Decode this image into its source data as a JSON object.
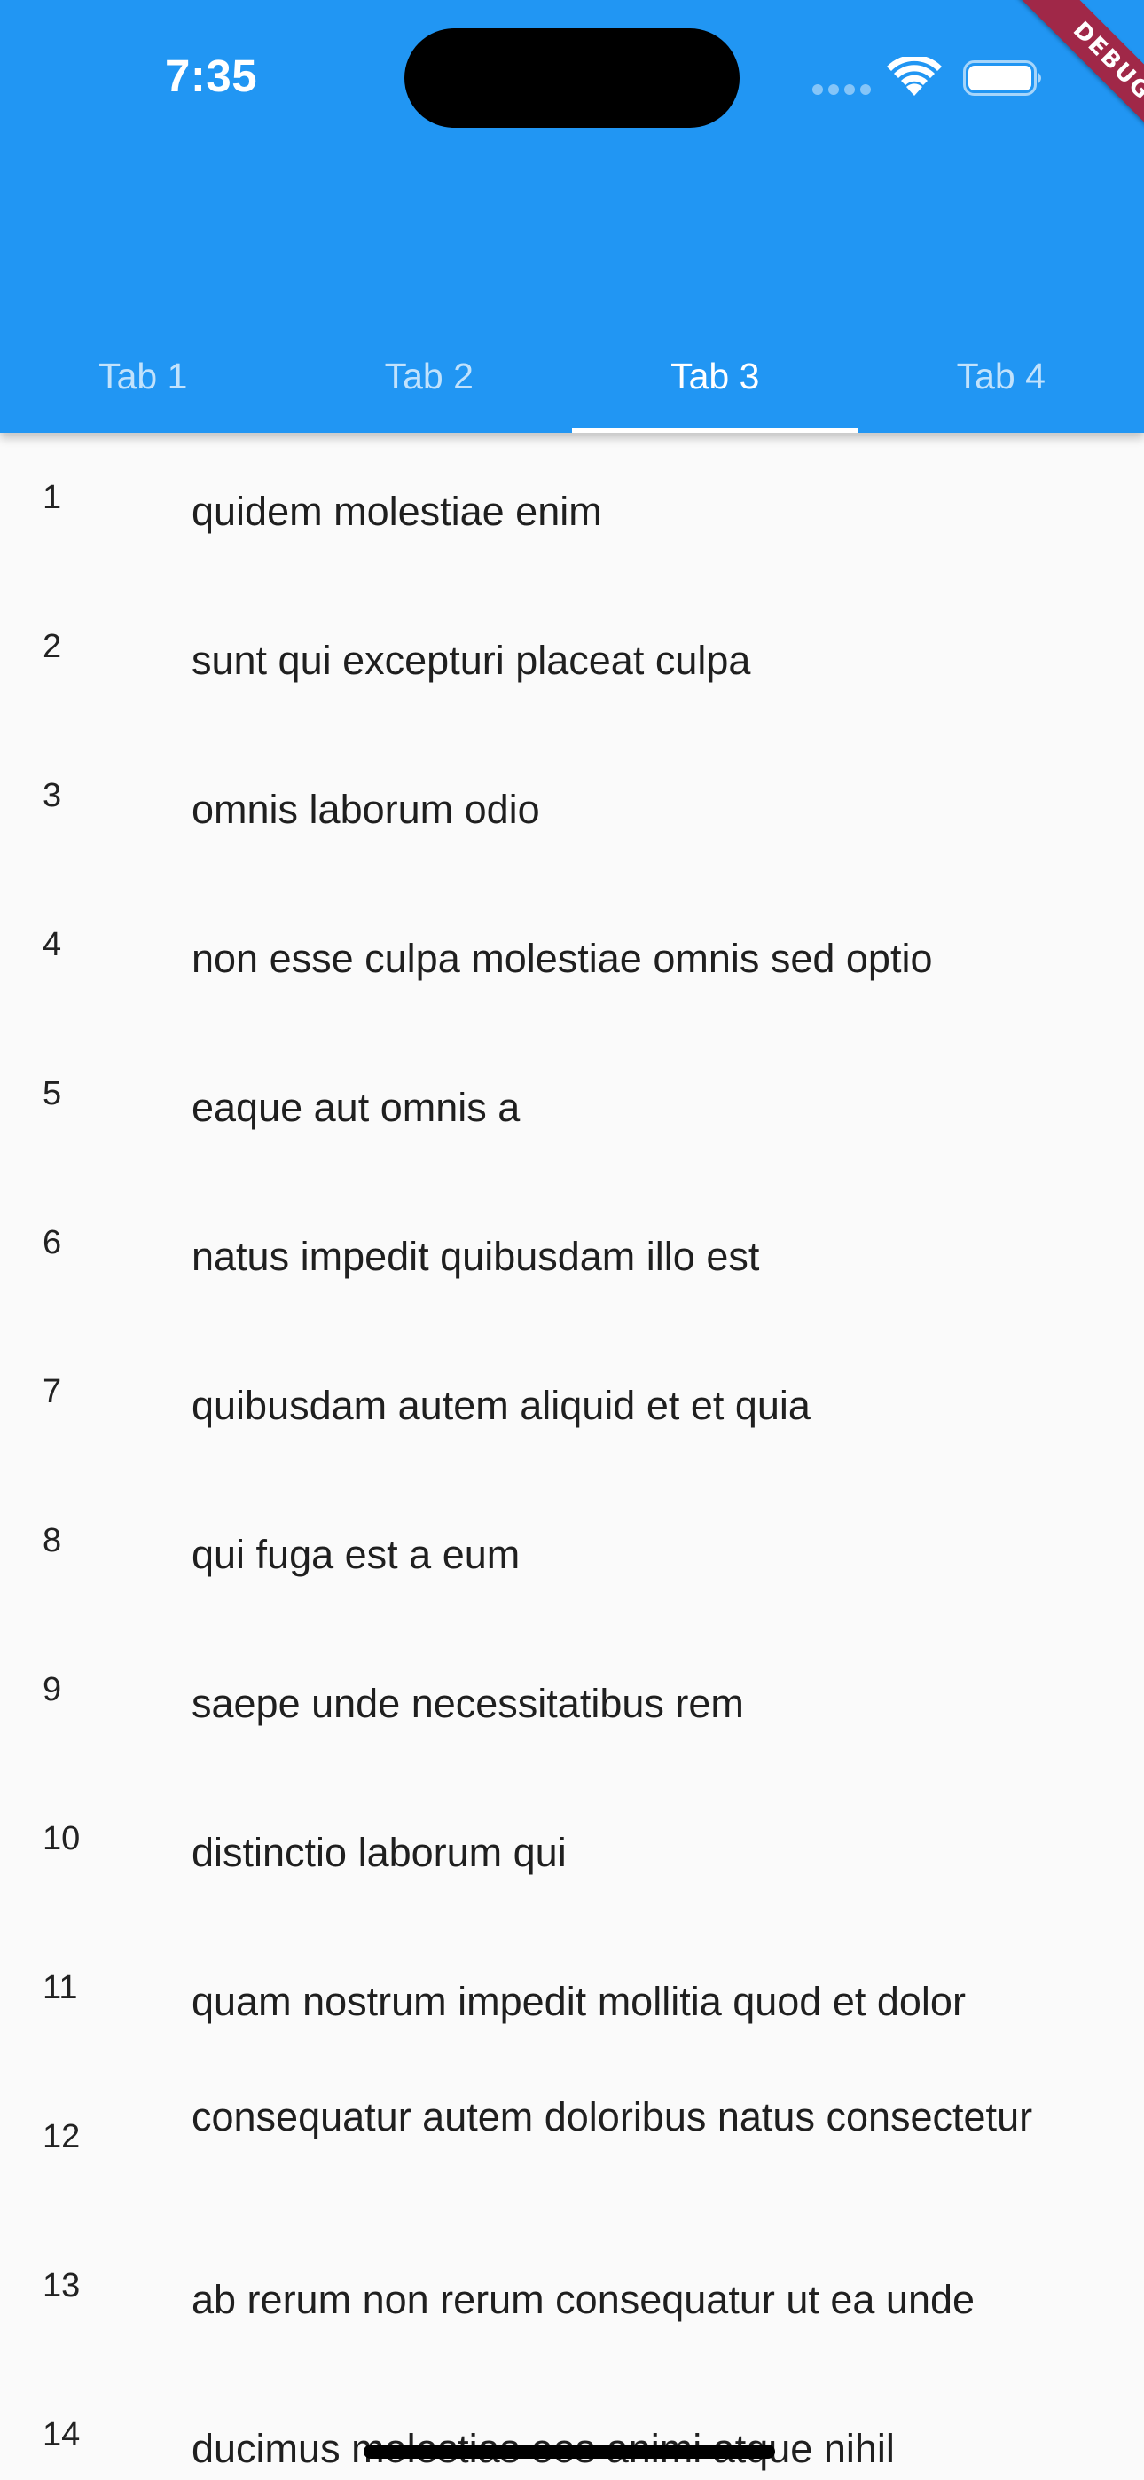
{
  "status_bar": {
    "time": "7:35"
  },
  "debug_banner": "DEBUG",
  "colors": {
    "app_bar": "#2196f3",
    "background": "#fafafa",
    "debug_ribbon": "#a02848"
  },
  "tabs": [
    {
      "label": "Tab 1",
      "selected": false
    },
    {
      "label": "Tab 2",
      "selected": false
    },
    {
      "label": "Tab 3",
      "selected": true
    },
    {
      "label": "Tab 4",
      "selected": false
    }
  ],
  "list": {
    "items": [
      {
        "index": "1",
        "text": "quidem molestiae enim"
      },
      {
        "index": "2",
        "text": "sunt qui excepturi placeat culpa"
      },
      {
        "index": "3",
        "text": "omnis laborum odio"
      },
      {
        "index": "4",
        "text": "non esse culpa molestiae omnis sed optio"
      },
      {
        "index": "5",
        "text": "eaque aut omnis a"
      },
      {
        "index": "6",
        "text": "natus impedit quibusdam illo est"
      },
      {
        "index": "7",
        "text": "quibusdam autem aliquid et et quia"
      },
      {
        "index": "8",
        "text": "qui fuga est a eum"
      },
      {
        "index": "9",
        "text": "saepe unde necessitatibus rem"
      },
      {
        "index": "10",
        "text": "distinctio laborum qui"
      },
      {
        "index": "11",
        "text": "quam nostrum impedit mollitia quod et dolor"
      },
      {
        "index": "12",
        "text": "consequatur autem doloribus natus consectetur"
      },
      {
        "index": "13",
        "text": "ab rerum non rerum consequatur ut ea unde"
      },
      {
        "index": "14",
        "text": "ducimus molestias eos animi atque nihil"
      }
    ]
  }
}
